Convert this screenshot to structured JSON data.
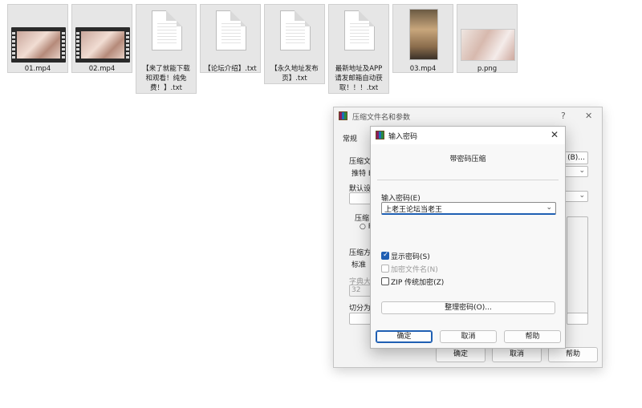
{
  "desktop": {
    "files": [
      {
        "name": "01.mp4",
        "kind": "video"
      },
      {
        "name": "02.mp4",
        "kind": "video"
      },
      {
        "name_lines": [
          "【来了就能下载",
          "和观看！纯免",
          "费！】.txt"
        ],
        "kind": "text"
      },
      {
        "name": "【论坛介绍】.txt",
        "kind": "text"
      },
      {
        "name_lines": [
          "【永久地址发布",
          "页】.txt"
        ],
        "kind": "text"
      },
      {
        "name_lines": [
          "最新地址及APP",
          "请发邮箱自动获",
          "取！！！.txt"
        ],
        "kind": "text"
      },
      {
        "name": "03.mp4",
        "kind": "video-portrait"
      },
      {
        "name": "p.png",
        "kind": "image"
      }
    ]
  },
  "archive_dialog": {
    "title": "压缩文件名和参数",
    "help_glyph": "?",
    "close_glyph": "✕",
    "tab_general": "常规",
    "label_archive_name_partial": "压缩文",
    "archive_name_value_partial": "推特 E",
    "browse_button_partial": "(B)...",
    "label_default_partial": "默认设",
    "label_format_partial": "压缩",
    "format_radio_partial": "R",
    "label_method_partial": "压缩方",
    "method_value": "标准",
    "label_dictionary_partial": "字典大",
    "dictionary_value": "32",
    "label_split_partial": "切分为",
    "ok": "确定",
    "cancel": "取消",
    "help": "帮助"
  },
  "password_dialog": {
    "title": "输入密码",
    "close_glyph": "✕",
    "subtitle": "带密码压缩",
    "password_label": "输入密码(E)",
    "password_value": "上老王论坛当老王",
    "show_password": {
      "label": "显示密码(S)",
      "checked": true,
      "enabled": true
    },
    "encrypt_filenames": {
      "label": "加密文件名(N)",
      "checked": false,
      "enabled": false
    },
    "zip_legacy": {
      "label": "ZIP 传统加密(Z)",
      "checked": false,
      "enabled": true
    },
    "organize_button": "整理密码(O)...",
    "ok": "确定",
    "cancel": "取消",
    "help": "帮助"
  },
  "colors": {
    "accent": "#1f5fb3",
    "file_tile_bg": "#e6e6e6",
    "dialog_bg": "#f3f3f3"
  }
}
